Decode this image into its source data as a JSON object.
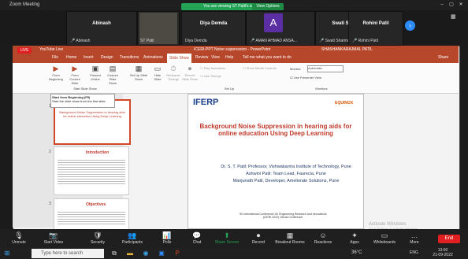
{
  "zoom": {
    "window_title": "Zoom Meeting",
    "share_banner": "You are viewing ST Patil's screen",
    "view_options": "View Options",
    "participants": [
      {
        "name": "Abinash",
        "sub": "Abinash"
      },
      {
        "name": "",
        "sub": "ST Patil"
      },
      {
        "name": "Diya Demda",
        "sub": "Diya Demda"
      },
      {
        "name": "",
        "sub": "AMAN AHMAD ANSA...",
        "initial": "A"
      },
      {
        "name": "Swati Sharma",
        "sub": "Swati Sharma"
      },
      {
        "name": "Rohini Patil",
        "sub": "Rohini Patil"
      }
    ],
    "live": "LIVE",
    "youtube_live": "YouTube Live",
    "toolbar": [
      {
        "label": "Unmute",
        "icon": "mic-off-icon",
        "glyph": "🎙"
      },
      {
        "label": "Start Video",
        "icon": "video-off-icon",
        "glyph": "📷"
      },
      {
        "label": "Security",
        "icon": "shield-icon",
        "glyph": "🛡"
      },
      {
        "label": "Participants",
        "icon": "participants-icon",
        "glyph": "👥"
      },
      {
        "label": "Polls",
        "icon": "polls-icon",
        "glyph": "📊"
      },
      {
        "label": "Chat",
        "icon": "chat-icon",
        "glyph": "💬"
      },
      {
        "label": "Share Screen",
        "icon": "share-screen-icon",
        "glyph": "⬆"
      },
      {
        "label": "Record",
        "icon": "record-icon",
        "glyph": "⏺"
      },
      {
        "label": "Breakout Rooms",
        "icon": "breakout-icon",
        "glyph": "▦"
      },
      {
        "label": "Reactions",
        "icon": "reactions-icon",
        "glyph": "☺"
      },
      {
        "label": "Apps",
        "icon": "apps-icon",
        "glyph": "✦"
      },
      {
        "label": "Whiteboards",
        "icon": "whiteboard-icon",
        "glyph": "▭"
      },
      {
        "label": "More",
        "icon": "more-icon",
        "glyph": "…"
      }
    ],
    "end": "End",
    "activate": "Activate Windows",
    "activate_sub": "Go to Settings to activate Windows."
  },
  "ppt": {
    "title": "ICERI-PPT Noise suppression - PowerPoint",
    "user": "SHASHANKARAJMAL PATIL",
    "tabs": [
      "File",
      "Home",
      "Insert",
      "Design",
      "Transitions",
      "Animations",
      "Slide Show",
      "Review",
      "View",
      "Help"
    ],
    "active_tab": "Slide Show",
    "tell_me": "Tell me what you want to do",
    "share": "Share",
    "ribbon": {
      "from_beginning": "From Beginning",
      "from_current": "From Current Slide",
      "present_online": "Present Online",
      "custom_show": "Custom Slide Show",
      "setup": "Set Up Slide Show",
      "hide_slide": "Hide Slide",
      "rehearse": "Rehearse Timings",
      "record": "Record Slide Show",
      "play_narrations": "Play Narrations",
      "use_timings": "Use Timings",
      "show_media": "Show Media Controls",
      "monitor_label": "Monitor:",
      "monitor_value": "Automatic",
      "presenter_view": "Use Presenter View",
      "group_start": "Start Slide Show",
      "group_setup": "Set Up",
      "group_monitors": "Monitors"
    },
    "tooltip": {
      "title": "Start from Beginning (F5)",
      "body": "Start the slide show from the first slide."
    },
    "slide": {
      "logo_left": "IFERP",
      "logo_right": "EQUINOX",
      "title": "Background Noise Suppression in hearing aids for online education Using Deep Learning",
      "authors": [
        "Dr. S. T. Patil: Professor, Vishwakarma Institute of Technology, Pune",
        "Ashwini Patil: Team Lead, Faurecia, Pune",
        "Manjunath Patil, Developer, Ameliorate Solutions, Pune"
      ],
      "conference": "7th International Conference On Engineering Research and Innovations (ICERI-2022) Virtual Conference"
    },
    "thumbs": [
      {
        "num": "1",
        "text": "Background Noise Suppression in hearing aids for online education Using Deep Learning"
      },
      {
        "num": "2",
        "text": "Introduction"
      },
      {
        "num": "3",
        "text": "Objectives"
      }
    ]
  },
  "taskbar": {
    "search": "Type here to search",
    "temp": "36°C",
    "lang": "ENG",
    "time": "13:00",
    "date": "21-09-2022"
  }
}
